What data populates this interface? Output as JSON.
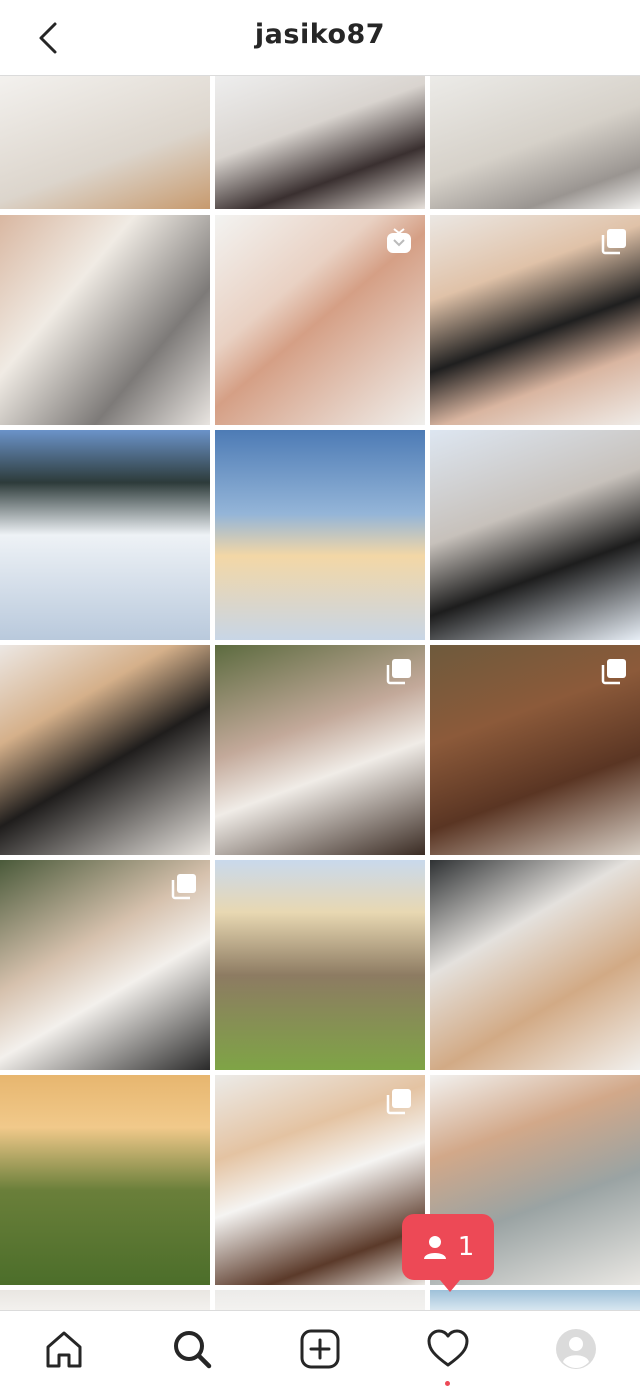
{
  "header": {
    "title": "jasiko87"
  },
  "tiles": [
    {
      "bg": "linear-gradient(160deg,#f3f1ee 0%,#dcd5cc 60%,#c79a6e 100%)",
      "badge": "none"
    },
    {
      "bg": "linear-gradient(160deg,#eeeeee 0%,#d9d4cf 40%,#3a3030 70%,#e6e0da 100%)",
      "badge": "none"
    },
    {
      "bg": "linear-gradient(160deg,#ecebe8 0%,#d6d1c9 50%,#9a9591 80%,#f1f0ee 100%)",
      "badge": "none"
    },
    {
      "bg": "linear-gradient(130deg,#d9b7a1 0%,#f0ebe4 35%,#7d7a78 70%,#e8e4e0 100%)",
      "badge": "none"
    },
    {
      "bg": "linear-gradient(140deg,#f3f3f1 0%,#e9d1c3 35%,#d59f85 50%,#f0efec 100%)",
      "badge": "igtv"
    },
    {
      "bg": "linear-gradient(160deg,#ebe7e3 0%,#e0c2a8 30%,#1f1f1f 55%,#d9b5a0 75%,#efebe7 100%)",
      "badge": "multi"
    },
    {
      "bg": "linear-gradient(180deg,#6b93c9 0%,#2d3b3a 25%,#eef2f6 50%,#b9c9dc 100%)",
      "badge": "none"
    },
    {
      "bg": "linear-gradient(180deg,#4d7bb5 0%,#94b5d8 40%,#f3d7a6 60%,#c8d6e6 100%)",
      "badge": "none"
    },
    {
      "bg": "linear-gradient(160deg,#dde6f1 0%,#c7c1bb 40%,#1d1d1d 65%,#e7eef6 100%)",
      "badge": "none"
    },
    {
      "bg": "linear-gradient(150deg,#ece7e3 0%,#d5b08a 30%,#1f1d1c 55%,#e8e4df 100%)",
      "badge": "none"
    },
    {
      "bg": "linear-gradient(160deg,#5c6b3f 0%,#c3a99a 40%,#f0ece7 60%,#3a2b23 100%)",
      "badge": "multi"
    },
    {
      "bg": "linear-gradient(160deg,#6e5a3c 0%,#8c5a3a 35%,#5a3523 65%,#d7cec4 100%)",
      "badge": "multi"
    },
    {
      "bg": "linear-gradient(150deg,#4a5a3a 0%,#d6c1ad 40%,#f3f0ec 60%,#2a2a2a 100%)",
      "badge": "multi"
    },
    {
      "bg": "linear-gradient(180deg,#c9d9ec 0%,#e8d8b2 25%,#8d7b62 55%,#7fa446 100%)",
      "badge": "none"
    },
    {
      "bg": "linear-gradient(150deg,#2f3234 0%,#e4e1dd 35%,#d2aa85 65%,#f1efec 100%)",
      "badge": "none"
    },
    {
      "bg": "linear-gradient(180deg,#e7b66f 0%,#f1c98a 25%,#6a7f3a 55%,#4c6e2a 100%)",
      "badge": "none"
    },
    {
      "bg": "linear-gradient(160deg,#ecebe8 0%,#e4c3a2 30%,#f5f4f2 50%,#5b3a2a 80%,#ece8e3 100%)",
      "badge": "multi"
    },
    {
      "bg": "linear-gradient(160deg,#f2f1ef 0%,#d2a889 30%,#9aa3a3 60%,#e9e7e3 100%)",
      "badge": "none"
    },
    {
      "bg": "linear-gradient(180deg,#e9e6e2 0%,#f3f1ee 100%)",
      "badge": "none"
    },
    {
      "bg": "linear-gradient(180deg,#ecebe9 0%,#f3f2f0 100%)",
      "badge": "none"
    },
    {
      "bg": "linear-gradient(180deg,#9fc1d9 0%,#d7e6f0 100%)",
      "badge": "none"
    }
  ],
  "tabs": {
    "home": "home-icon",
    "search": "search-icon",
    "create": "add-post-icon",
    "activity": "heart-icon",
    "profile": "avatar-icon"
  },
  "notification": {
    "count": "1"
  },
  "colors": {
    "accent": "#ed4956",
    "text": "#262626",
    "border": "#dbdbdb"
  }
}
